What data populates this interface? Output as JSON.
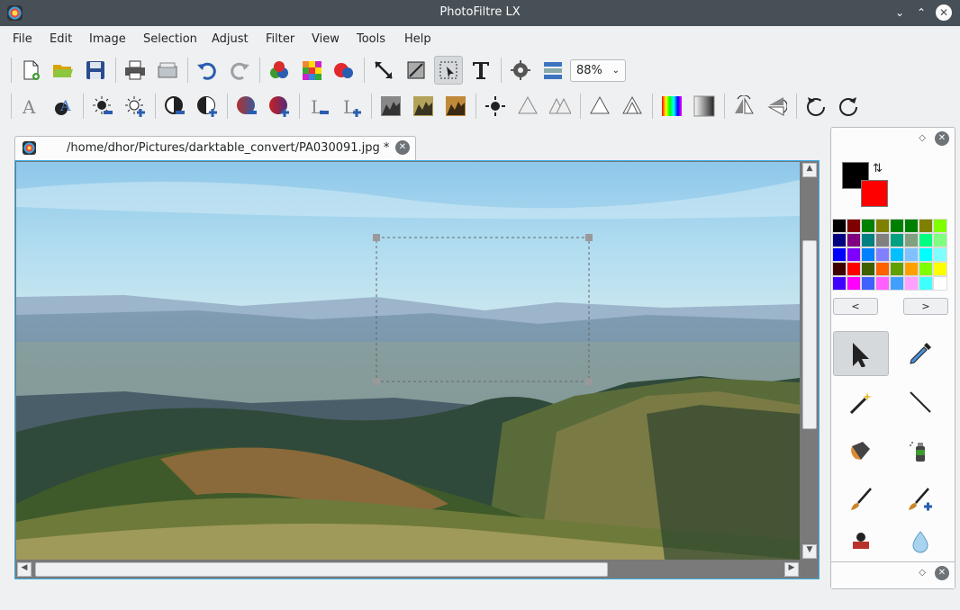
{
  "window": {
    "title": "PhotoFiltre LX"
  },
  "menu": [
    "File",
    "Edit",
    "Image",
    "Selection",
    "Adjust",
    "Filter",
    "View",
    "Tools",
    "Help"
  ],
  "toolbar": {
    "zoom_value": "88%"
  },
  "document": {
    "tab_title": "/home/dhor/Pictures/darktable_convert/PA030091.jpg *"
  },
  "panel": {
    "prev_label": "<",
    "next_label": ">",
    "palette": [
      "#000000",
      "#800000",
      "#008000",
      "#808000",
      "#008000",
      "#008000",
      "#808000",
      "#80ff00",
      "#000080",
      "#800080",
      "#008080",
      "#808080",
      "#00a080",
      "#80a080",
      "#00ff80",
      "#80ff80",
      "#0000ff",
      "#8000ff",
      "#0080ff",
      "#8080ff",
      "#00c0ff",
      "#80c0ff",
      "#00ffff",
      "#80ffff",
      "#400000",
      "#ff0000",
      "#406000",
      "#ff6000",
      "#60a000",
      "#ffa000",
      "#80ff00",
      "#ffff00",
      "#4000ff",
      "#ff00ff",
      "#4060ff",
      "#ff60ff",
      "#40a0ff",
      "#ffa0ff",
      "#40ffff",
      "#ffffff"
    ],
    "foreground": "#000000",
    "background": "#ff0000"
  }
}
